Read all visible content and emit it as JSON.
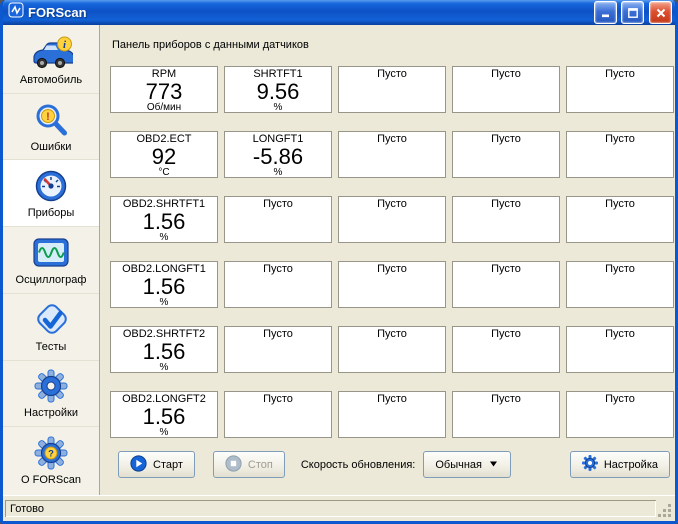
{
  "window": {
    "title": "FORScan"
  },
  "header": {
    "text": "Панель приборов с данными датчиков"
  },
  "sidebar": {
    "items": [
      {
        "label": "Автомобиль",
        "icon": "car-info-icon",
        "selected": false
      },
      {
        "label": "Ошибки",
        "icon": "search-warning-icon",
        "selected": false
      },
      {
        "label": "Приборы",
        "icon": "gauge-icon",
        "selected": true
      },
      {
        "label": "Осциллограф",
        "icon": "oscilloscope-icon",
        "selected": false
      },
      {
        "label": "Тесты",
        "icon": "check-icon",
        "selected": false
      },
      {
        "label": "Настройки",
        "icon": "gear-icon",
        "selected": false
      },
      {
        "label": "О FORScan",
        "icon": "gear-question-icon",
        "selected": false
      }
    ]
  },
  "grid": {
    "cells": [
      {
        "title": "RPM",
        "value": "773",
        "unit": "Об/мин"
      },
      {
        "title": "SHRTFT1",
        "value": "9.56",
        "unit": "%"
      },
      {
        "title": "Пусто",
        "value": "",
        "unit": ""
      },
      {
        "title": "Пусто",
        "value": "",
        "unit": ""
      },
      {
        "title": "Пусто",
        "value": "",
        "unit": ""
      },
      {
        "title": "OBD2.ECT",
        "value": "92",
        "unit": "°C"
      },
      {
        "title": "LONGFT1",
        "value": "-5.86",
        "unit": "%"
      },
      {
        "title": "Пусто",
        "value": "",
        "unit": ""
      },
      {
        "title": "Пусто",
        "value": "",
        "unit": ""
      },
      {
        "title": "Пусто",
        "value": "",
        "unit": ""
      },
      {
        "title": "OBD2.SHRTFT1",
        "value": "1.56",
        "unit": "%"
      },
      {
        "title": "Пусто",
        "value": "",
        "unit": ""
      },
      {
        "title": "Пусто",
        "value": "",
        "unit": ""
      },
      {
        "title": "Пусто",
        "value": "",
        "unit": ""
      },
      {
        "title": "Пусто",
        "value": "",
        "unit": ""
      },
      {
        "title": "OBD2.LONGFT1",
        "value": "1.56",
        "unit": "%"
      },
      {
        "title": "Пусто",
        "value": "",
        "unit": ""
      },
      {
        "title": "Пусто",
        "value": "",
        "unit": ""
      },
      {
        "title": "Пусто",
        "value": "",
        "unit": ""
      },
      {
        "title": "Пусто",
        "value": "",
        "unit": ""
      },
      {
        "title": "OBD2.SHRTFT2",
        "value": "1.56",
        "unit": "%"
      },
      {
        "title": "Пусто",
        "value": "",
        "unit": ""
      },
      {
        "title": "Пусто",
        "value": "",
        "unit": ""
      },
      {
        "title": "Пусто",
        "value": "",
        "unit": ""
      },
      {
        "title": "Пусто",
        "value": "",
        "unit": ""
      },
      {
        "title": "OBD2.LONGFT2",
        "value": "1.56",
        "unit": "%"
      },
      {
        "title": "Пусто",
        "value": "",
        "unit": ""
      },
      {
        "title": "Пусто",
        "value": "",
        "unit": ""
      },
      {
        "title": "Пусто",
        "value": "",
        "unit": ""
      },
      {
        "title": "Пусто",
        "value": "",
        "unit": ""
      }
    ]
  },
  "controls": {
    "start_label": "Старт",
    "stop_label": "Стоп",
    "rate_label": "Скорость обновления:",
    "rate_value": "Обычная",
    "settings_label": "Настройка"
  },
  "statusbar": {
    "text": "Готово"
  },
  "colors": {
    "titlebar_blue": "#0d52c6",
    "accent_blue": "#2b6fd9",
    "warning_yellow": "#ffd23e",
    "window_bg": "#ece9d8",
    "cell_border": "#989689"
  }
}
